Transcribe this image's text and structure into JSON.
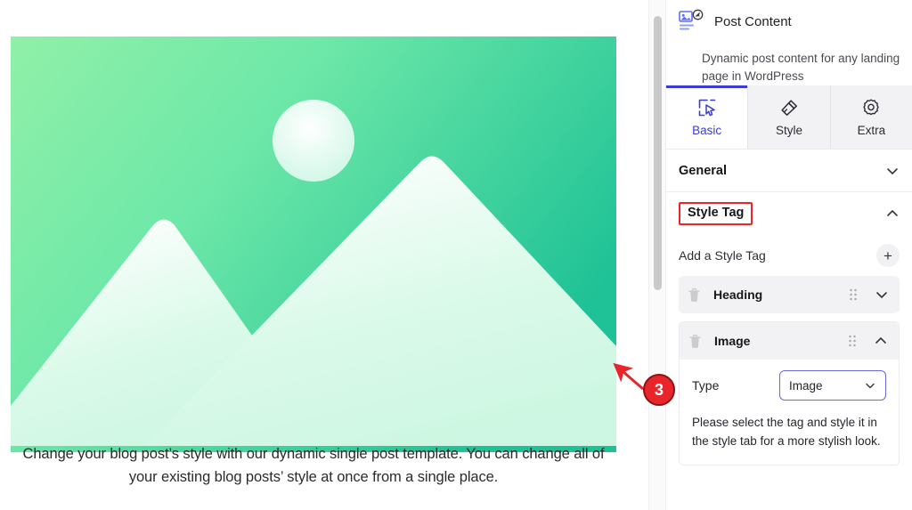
{
  "canvas": {
    "post_caption": "Change your blog post’s style with our dynamic single post template. You can change all of your existing blog posts’ style at once from a single place.",
    "image_placeholder_name": "image-placeholder"
  },
  "panel": {
    "widget": {
      "title": "Post Content",
      "description": "Dynamic post content for any landing page in WordPress",
      "icon": "post-content-icon"
    },
    "tabs": [
      {
        "label": "Basic",
        "icon": "cursor-select-icon",
        "active": true
      },
      {
        "label": "Style",
        "icon": "paint-brush-icon",
        "active": false
      },
      {
        "label": "Extra",
        "icon": "gear-icon",
        "active": false
      }
    ],
    "sections": [
      {
        "label": "General",
        "expanded": false,
        "highlighted": false,
        "chevron": "chevron-down"
      },
      {
        "label": "Style Tag",
        "expanded": true,
        "highlighted": true,
        "chevron": "chevron-up"
      }
    ],
    "add_style_tag": {
      "label": "Add a Style Tag",
      "button_glyph": "+"
    },
    "style_tags": [
      {
        "name": "Heading",
        "expanded": false,
        "chevron": "chevron-down"
      },
      {
        "name": "Image",
        "expanded": true,
        "chevron": "chevron-up",
        "field_label": "Type",
        "field_value": "Image",
        "help_text": "Please select the tag and style it in the style tab for a more stylish look."
      }
    ]
  },
  "annotation": {
    "step_number": "3",
    "color": "#e8252a"
  },
  "colors": {
    "accent_blue": "#3b3bcf",
    "select_border": "#6a6ad8",
    "annotation_red": "#e8252a",
    "image_gradient_from": "#86efac",
    "image_gradient_to": "#22c38f",
    "mountain_fill": "#d5f8e6",
    "panel_bg": "#ffffff",
    "tab_inactive_bg": "#f2f2f4"
  }
}
